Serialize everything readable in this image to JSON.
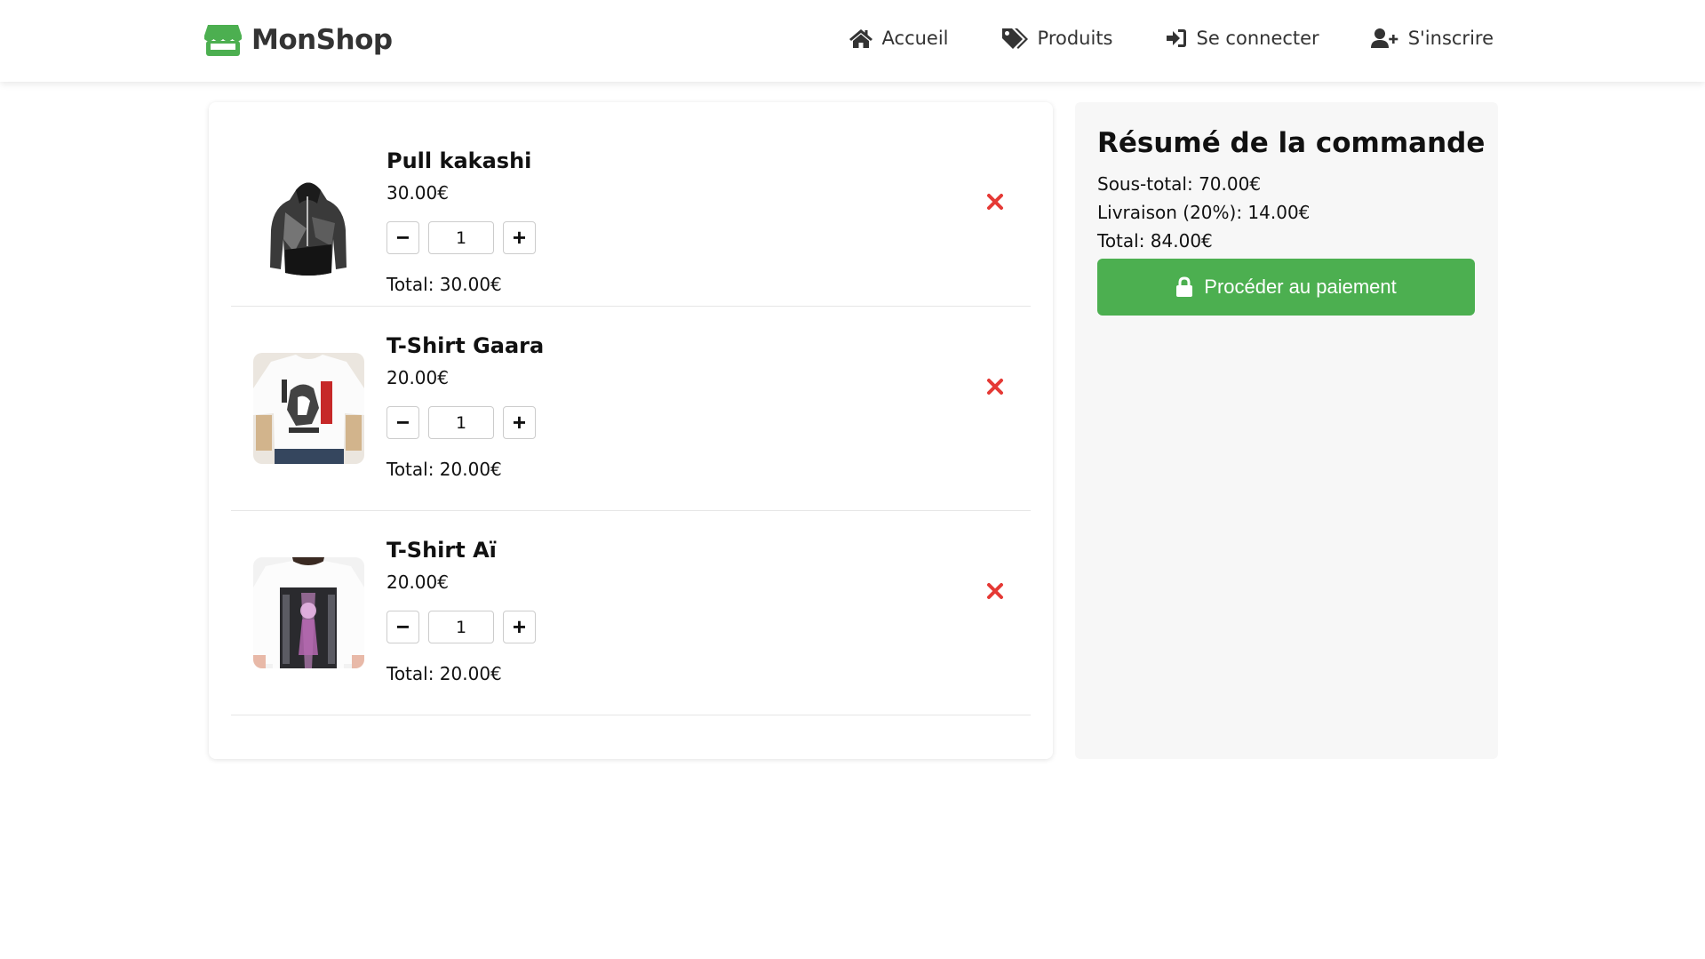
{
  "header": {
    "brand": "MonShop",
    "brand_color": "#4caf50",
    "nav": [
      {
        "label": "Accueil",
        "icon": "home-icon"
      },
      {
        "label": "Produits",
        "icon": "tags-icon"
      },
      {
        "label": "Se connecter",
        "icon": "sign-in-icon"
      },
      {
        "label": "S'inscrire",
        "icon": "user-plus-icon"
      }
    ]
  },
  "cart": {
    "items": [
      {
        "name": "Pull kakashi",
        "price": "30.00€",
        "quantity": "1",
        "total": "Total: 30.00€"
      },
      {
        "name": "T-Shirt Gaara",
        "price": "20.00€",
        "quantity": "1",
        "total": "Total: 20.00€"
      },
      {
        "name": "T-Shirt Aï",
        "price": "20.00€",
        "quantity": "1",
        "total": "Total: 20.00€"
      }
    ],
    "minus_label": "−",
    "plus_label": "+",
    "remove_color": "#e53935"
  },
  "summary": {
    "title": "Résumé de la commande",
    "subtotal": "Sous-total: 70.00€",
    "shipping": "Livraison (20%): 14.00€",
    "total": "Total: 84.00€",
    "checkout_label": "Procéder au paiement",
    "checkout_color": "#4caf50"
  }
}
